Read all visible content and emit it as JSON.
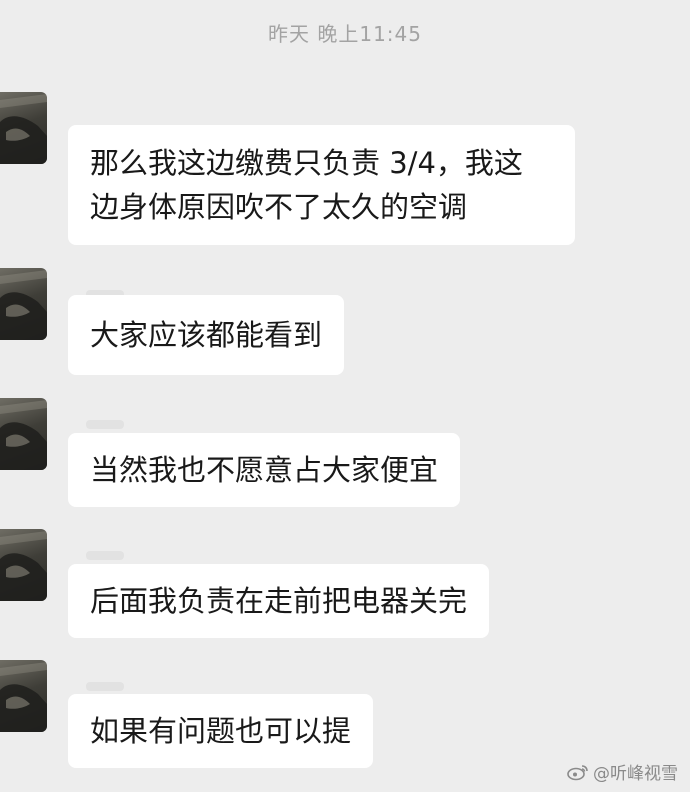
{
  "chat": {
    "timestamp": "昨天 晚上11:45",
    "messages": [
      {
        "text": "那么我这边缴费只负责 3/4，我这\n边身体原因吹不了太久的空调"
      },
      {
        "text": "大家应该都能看到"
      },
      {
        "text": "当然我也不愿意占大家便宜"
      },
      {
        "text": "后面我负责在走前把电器关完"
      },
      {
        "text": "如果有问题也可以提"
      }
    ]
  },
  "watermark": {
    "icon": "weibo-logo-icon",
    "text": "@听峰视雪"
  }
}
